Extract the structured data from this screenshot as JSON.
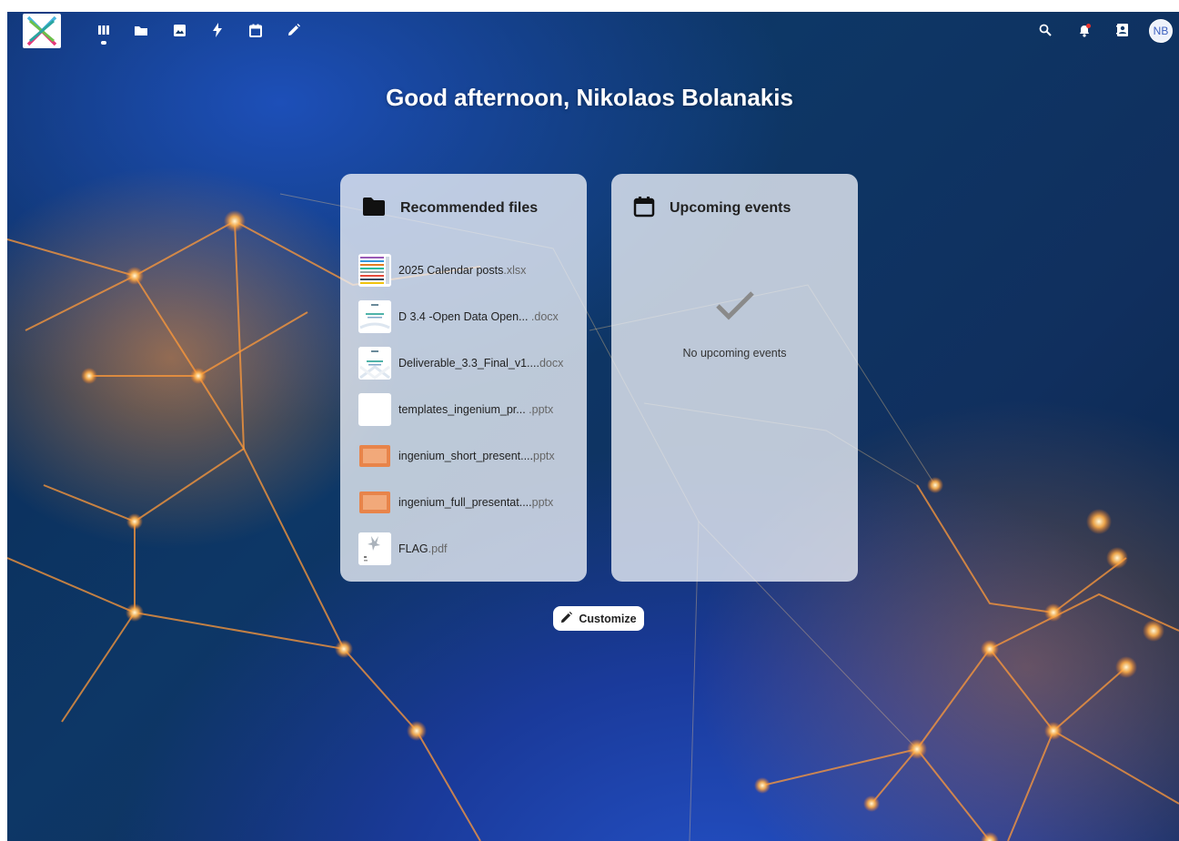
{
  "topbar": {
    "apps": [
      {
        "name": "dashboard-icon"
      },
      {
        "name": "files-icon"
      },
      {
        "name": "photos-icon"
      },
      {
        "name": "activity-icon"
      },
      {
        "name": "calendar-icon"
      },
      {
        "name": "notes-icon"
      }
    ],
    "right_icons": [
      {
        "name": "search-icon"
      },
      {
        "name": "notifications-icon"
      },
      {
        "name": "contacts-icon"
      }
    ],
    "avatar_initials": "NB"
  },
  "greeting": "Good afternoon, Nikolaos Bolanakis",
  "recommended": {
    "title": "Recommended files",
    "files": [
      {
        "name": "2025 Calendar posts",
        "ext": ".xlsx",
        "thumb": "spreadsheet"
      },
      {
        "name": "D 3.4 -Open Data Open...",
        "ext": " .docx",
        "thumb": "document"
      },
      {
        "name": "Deliverable_3.3_Final_v1....",
        "ext": "docx",
        "thumb": "document"
      },
      {
        "name": "templates_ingenium_pr...",
        "ext": " .pptx",
        "thumb": "blank"
      },
      {
        "name": "ingenium_short_present....",
        "ext": "pptx",
        "thumb": "slide"
      },
      {
        "name": "ingenium_full_presentat....",
        "ext": "pptx",
        "thumb": "slide"
      },
      {
        "name": "FLAG",
        "ext": ".pdf",
        "thumb": "pdf"
      }
    ]
  },
  "events": {
    "title": "Upcoming events",
    "empty_text": "No upcoming events"
  },
  "customize_label": "Customize",
  "colors": {
    "slide_orange": "#e8844a",
    "panel_bg": "rgba(238,242,248,0.78)",
    "check_gray": "#8a8a8a"
  }
}
